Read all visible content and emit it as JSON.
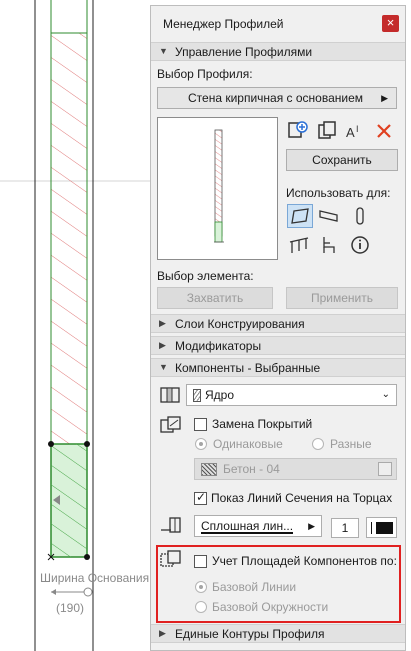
{
  "canvas": {
    "dimension_label": "Ширина Основания",
    "dimension_value": "(190)"
  },
  "panel": {
    "title": "Менеджер Профилей",
    "close_glyph": "×",
    "sections": {
      "manage": "Управление Профилями",
      "layers": "Слои Конструирования",
      "modifiers": "Модификаторы",
      "components": "Компоненты - Выбранные",
      "contours": "Единые Контуры Профиля"
    },
    "profile_select_label": "Выбор Профиля:",
    "profile_selected": "Стена кирпичная с основанием",
    "save_label": "Сохранить",
    "use_for_label": "Использовать для:",
    "element_select_label": "Выбор элемента:",
    "capture_label": "Захватить",
    "apply_label": "Применить",
    "component_value": "Ядро",
    "replace_surface_label": "Замена Покрытий",
    "same_label": "Одинаковые",
    "different_label": "Разные",
    "material_value": "Бетон - 04",
    "show_section_lines_label": "Показ Линий Сечения на Торцах",
    "line_type_value": "Сплошная лин...",
    "pen_value": "1",
    "area_label": "Учет Площадей Компонентов по:",
    "base_line_label": "Базовой Линии",
    "base_circle_label": "Базовой Окружности"
  },
  "icons": [
    "section-arrow-icon",
    "chevron-right-icon",
    "new-profile-icon",
    "duplicate-profile-icon",
    "rename-icon",
    "delete-icon",
    "wall-icon",
    "beam-icon",
    "column-icon",
    "railing-icon",
    "chair-icon",
    "info-icon",
    "component-icon",
    "surface-icon",
    "line-icon",
    "area-icon"
  ],
  "colors": {
    "accent_red": "#e02020",
    "close_red": "#c42b2b",
    "hatch_red": "#e07070",
    "core_green": "#2e8b2e"
  }
}
